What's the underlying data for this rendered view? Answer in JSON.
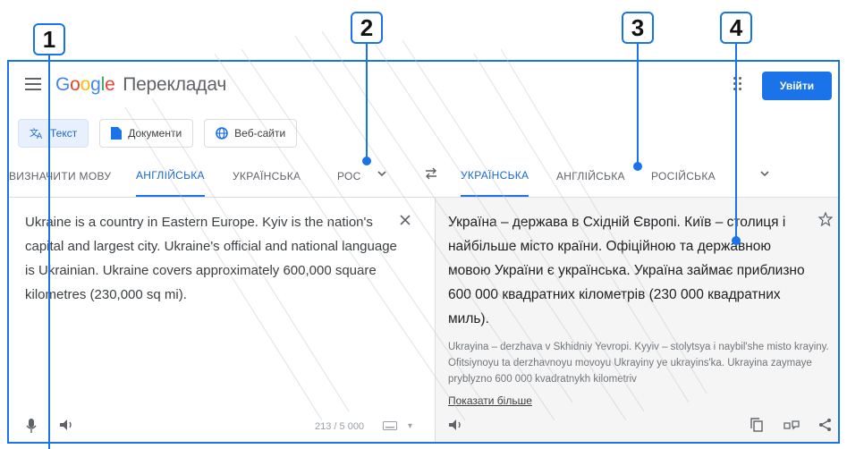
{
  "callouts": [
    "1",
    "2",
    "3",
    "4"
  ],
  "app": {
    "logo_google": [
      "G",
      "o",
      "o",
      "g",
      "l",
      "e"
    ],
    "product_name": "Перекладач",
    "sign_in_label": "Увійти",
    "accent_color": "#1a73e8"
  },
  "modes": [
    {
      "label": "Текст",
      "icon": "translate-icon",
      "active": true
    },
    {
      "label": "Документи",
      "icon": "document-icon",
      "active": false
    },
    {
      "label": "Веб-сайти",
      "icon": "globe-icon",
      "active": false
    }
  ],
  "source_languages": [
    "ВИЗНАЧИТИ МОВУ",
    "АНГЛІЙСЬКА",
    "УКРАЇНСЬКА",
    "РОС"
  ],
  "source_active": "АНГЛІЙСЬКА",
  "target_languages": [
    "УКРАЇНСЬКА",
    "АНГЛІЙСЬКА",
    "РОСІЙСЬКА"
  ],
  "target_active": "УКРАЇНСЬКА",
  "source": {
    "text": "Ukraine is a country in Eastern Europe. Kyiv is the nation's capital and largest city. Ukraine's official and national language is Ukrainian. Ukraine covers approximately 600,000 square kilometres (230,000 sq mi).",
    "char_count": "213 / 5 000"
  },
  "target": {
    "text": "Україна – держава в Східній Європі. Київ – столиця і найбільше місто країни. Офіційною та державною мовою України є українська. Україна займає приблизно 600 000 квадратних кілометрів (230 000 квадратних миль).",
    "transliteration": "Ukrayina – derzhava v Skhidniy Yevropi. Kyyiv – stolytsya i naybil'she misto krayiny. Ofitsiynoyu ta derzhavnoyu movoyu Ukrayiny ye ukrayins'ka. Ukrayina zaymaye pryblyzno 600 000 kvadratnykh kilometriv",
    "show_more": "Показати більше"
  },
  "icons": {
    "menu": "menu-icon",
    "apps": "apps-icon",
    "swap": "swap-icon",
    "clear": "close-icon",
    "star": "star-icon",
    "mic": "mic-icon",
    "speaker": "speaker-icon",
    "keyboard": "keyboard-icon",
    "copy": "copy-icon",
    "feedback": "feedback-icon",
    "share": "share-icon"
  }
}
